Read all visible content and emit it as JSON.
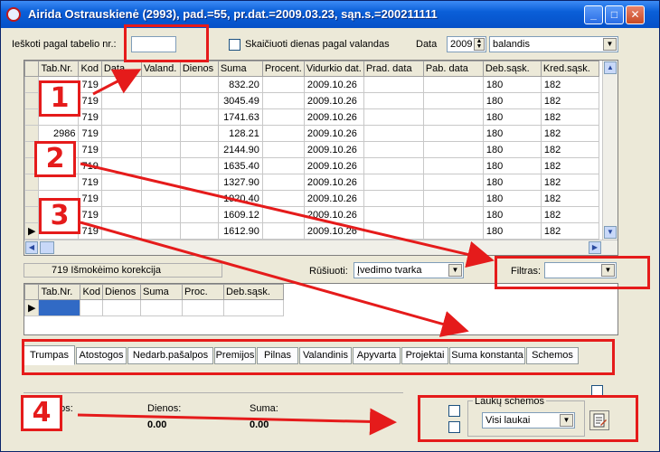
{
  "window": {
    "title": "Airida Ostrauskienė (2993), pad.=55, pr.dat.=2009.03.23, sąn.s.=200211111",
    "min_glyph": "_",
    "max_glyph": "□",
    "close_glyph": "✕"
  },
  "top": {
    "search_label": "Ieškoti pagal tabelio nr.:",
    "search_value": "",
    "calc_checkbox_label": "Skaičiuoti dienas pagal valandas",
    "data_label": "Data",
    "year": "2009",
    "month": "balandis"
  },
  "main_grid": {
    "columns": [
      "Tab.Nr.",
      "Kod",
      "Data",
      "Valand.",
      "Dienos",
      "Suma",
      "Procent.",
      "Vidurkio dat.",
      "Prad. data",
      "Pab. data",
      "Deb.sąsk.",
      "Kred.sąsk."
    ],
    "rows": [
      {
        "tab": "",
        "kod": "719",
        "data": "",
        "valand": "",
        "dienos": "",
        "suma": "832.20",
        "procent": "",
        "vid_dat": "2009.10.26",
        "prad": "",
        "pab": "",
        "deb": "180",
        "kred": "182"
      },
      {
        "tab": "",
        "kod": "719",
        "data": "",
        "valand": "",
        "dienos": "",
        "suma": "3045.49",
        "procent": "",
        "vid_dat": "2009.10.26",
        "prad": "",
        "pab": "",
        "deb": "180",
        "kred": "182"
      },
      {
        "tab": "",
        "kod": "719",
        "data": "",
        "valand": "",
        "dienos": "",
        "suma": "1741.63",
        "procent": "",
        "vid_dat": "2009.10.26",
        "prad": "",
        "pab": "",
        "deb": "180",
        "kred": "182"
      },
      {
        "tab": "2986",
        "kod": "719",
        "data": "",
        "valand": "",
        "dienos": "",
        "suma": "128.21",
        "procent": "",
        "vid_dat": "2009.10.26",
        "prad": "",
        "pab": "",
        "deb": "180",
        "kred": "182"
      },
      {
        "tab": "",
        "kod": "719",
        "data": "",
        "valand": "",
        "dienos": "",
        "suma": "2144.90",
        "procent": "",
        "vid_dat": "2009.10.26",
        "prad": "",
        "pab": "",
        "deb": "180",
        "kred": "182"
      },
      {
        "tab": "",
        "kod": "719",
        "data": "",
        "valand": "",
        "dienos": "",
        "suma": "1635.40",
        "procent": "",
        "vid_dat": "2009.10.26",
        "prad": "",
        "pab": "",
        "deb": "180",
        "kred": "182"
      },
      {
        "tab": "",
        "kod": "719",
        "data": "",
        "valand": "",
        "dienos": "",
        "suma": "1327.90",
        "procent": "",
        "vid_dat": "2009.10.26",
        "prad": "",
        "pab": "",
        "deb": "180",
        "kred": "182"
      },
      {
        "tab": "",
        "kod": "719",
        "data": "",
        "valand": "",
        "dienos": "",
        "suma": "1920.40",
        "procent": "",
        "vid_dat": "2009.10.26",
        "prad": "",
        "pab": "",
        "deb": "180",
        "kred": "182"
      },
      {
        "tab": "",
        "kod": "719",
        "data": "",
        "valand": "",
        "dienos": "",
        "suma": "1609.12",
        "procent": "",
        "vid_dat": "2009.10.26",
        "prad": "",
        "pab": "",
        "deb": "180",
        "kred": "182"
      },
      {
        "tab": "",
        "kod": "719",
        "data": "",
        "valand": "",
        "dienos": "",
        "suma": "1612.90",
        "procent": "",
        "vid_dat": "2009.10.26",
        "prad": "",
        "pab": "",
        "deb": "180",
        "kred": "182"
      }
    ]
  },
  "middle": {
    "status_text": "719 Išmokėimo korekcija",
    "sort_label": "Rūšiuoti:",
    "sort_value": "Įvedimo tvarka",
    "filter_label": "Filtras:",
    "filter_value": ""
  },
  "sub_grid": {
    "columns": [
      "Tab.Nr.",
      "Kod",
      "Dienos",
      "Suma",
      "Proc.",
      "Deb.sąsk."
    ]
  },
  "tabs": [
    "Trumpas",
    "Atostogos",
    "Nedarb.pašalpos",
    "Premijos",
    "Pilnas",
    "Valandinis",
    "Apyvarta",
    "Projektai",
    "Suma konstanta",
    "Schemos"
  ],
  "bottom": {
    "col1_label": "dos:",
    "col2_label": "Dienos:",
    "col2_value": "0.00",
    "col3_label": "Suma:",
    "col3_value": "0.00",
    "schema_title": "Laukų schemos",
    "schema_value": "Visi laukai"
  },
  "annotations": [
    "1",
    "2",
    "3",
    "4"
  ],
  "colors": {
    "annotation_red": "#e51b1b",
    "titlebar_blue": "#0550c8",
    "window_bg": "#ece9d8"
  }
}
